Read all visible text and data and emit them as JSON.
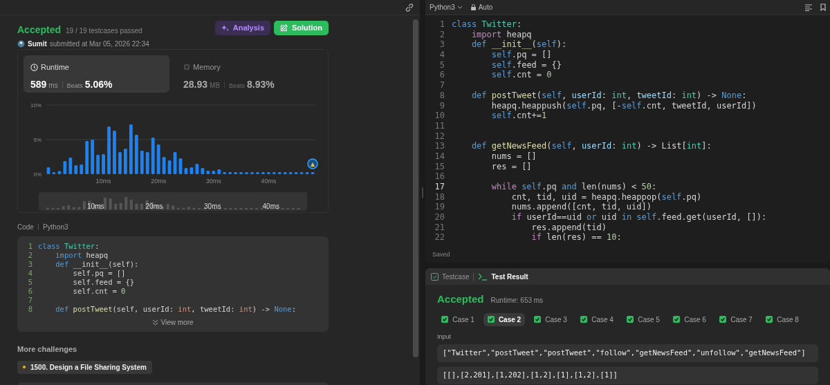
{
  "left_panel": {
    "status": "Accepted",
    "testcases": "19 / 19 testcases passed",
    "user": "Sumit",
    "submitted": "submitted at Mar 05, 2026 22:34",
    "buttons": [
      {
        "label": "Analysis",
        "kind": "analysis"
      },
      {
        "label": "Solution",
        "kind": "solution"
      }
    ],
    "metrics": [
      {
        "label": "Runtime",
        "value": "589",
        "unit": "ms",
        "beats_label": "Beats",
        "beats": "5.06%",
        "selected": true,
        "kind": "clock"
      },
      {
        "label": "Memory",
        "value": "28.93",
        "unit": "MB",
        "beats_label": "Beats",
        "beats": "8.93%",
        "selected": false,
        "kind": "chip"
      }
    ],
    "chart_data": {
      "type": "bar",
      "x": [
        0,
        1,
        2,
        3,
        4,
        5,
        6,
        7,
        8,
        9,
        10,
        11,
        12,
        13,
        14,
        15,
        16,
        17,
        18,
        19,
        20,
        21,
        22,
        23,
        24,
        25,
        26,
        27,
        28,
        29,
        30,
        31,
        32,
        33,
        34,
        35,
        36,
        37,
        38,
        39,
        40,
        41,
        42,
        43,
        44,
        45,
        46,
        47,
        48
      ],
      "values": [
        1.0,
        0.3,
        0.45,
        1.9,
        2.4,
        1.3,
        1.4,
        4.8,
        5.0,
        2.8,
        2.9,
        6.9,
        6.3,
        3.2,
        3.7,
        7.2,
        5.7,
        3.4,
        3.2,
        5.3,
        4.3,
        2.5,
        2.0,
        3.2,
        2.3,
        0.9,
        1.0,
        1.5,
        0.9,
        0.5,
        0.5,
        0.7,
        0.3,
        0.3,
        0.3,
        0.3,
        0.3,
        0.3,
        0.3,
        0.3,
        0.3,
        0.3,
        0.3,
        0.3,
        0.3,
        0.3,
        0.3,
        0.3,
        0.3
      ],
      "xlim": [
        -0.5,
        48.5
      ],
      "ylim": [
        0,
        10
      ],
      "yticks": [
        {
          "value": 0,
          "label": "0%"
        },
        {
          "value": 5,
          "label": "5%"
        },
        {
          "value": 10,
          "label": "10%"
        }
      ],
      "xticks": [
        {
          "value": 10,
          "label": "10ms"
        },
        {
          "value": 20,
          "label": "20ms"
        },
        {
          "value": 30,
          "label": "30ms"
        },
        {
          "value": 40,
          "label": "40ms"
        }
      ]
    },
    "overview_ticks": [
      "10ms",
      "20ms",
      "30ms",
      "40ms"
    ],
    "code_label": "Code",
    "code_language": "Python3",
    "code_lines": [
      {
        "n": "1",
        "tokens": [
          {
            "text": "class",
            "kind": "kw"
          },
          {
            "text": " Twitter",
            "kind": "cls"
          },
          {
            "text": ":",
            "kind": "p"
          }
        ]
      },
      {
        "n": "2",
        "tokens": [
          {
            "text": "    import",
            "kind": "kw"
          },
          {
            "text": " heapq",
            "kind": "p"
          }
        ]
      },
      {
        "n": "3",
        "tokens": [
          {
            "text": "    def",
            "kind": "kw"
          },
          {
            "text": " __init__(self):",
            "kind": "p"
          }
        ]
      },
      {
        "n": "4",
        "tokens": [
          {
            "text": "        self.pq = []",
            "kind": "p"
          }
        ]
      },
      {
        "n": "5",
        "tokens": [
          {
            "text": "        self.feed = {}",
            "kind": "p"
          }
        ]
      },
      {
        "n": "6",
        "tokens": [
          {
            "text": "        self.cnt = ",
            "kind": "p"
          },
          {
            "text": "0",
            "kind": "num"
          }
        ]
      },
      {
        "n": "7"
      },
      {
        "n": "8",
        "tokens": [
          {
            "text": "    def",
            "kind": "kw"
          },
          {
            "text": " postTweet",
            "kind": "fn"
          },
          {
            "text": "(self, userId: ",
            "kind": "p"
          },
          {
            "text": "int",
            "kind": "type"
          },
          {
            "text": ", tweetId: ",
            "kind": "p"
          },
          {
            "text": "int",
            "kind": "type"
          },
          {
            "text": ") -> ",
            "kind": "p"
          },
          {
            "text": "None",
            "kind": "kw"
          },
          {
            "text": ":",
            "kind": "p"
          }
        ]
      }
    ],
    "view_more": "View more",
    "more_challenges": "More challenges",
    "challenges": [
      {
        "title": "1500. Design a File Sharing System",
        "color": "#f5b800"
      }
    ]
  },
  "editor": {
    "language": "Python3",
    "mode": "Auto",
    "status": "Saved",
    "lines": [
      {
        "n": "1",
        "current": false,
        "tokens": [
          {
            "text": "class",
            "kind": "kw"
          },
          {
            "text": " Twitter",
            "kind": "cls"
          },
          {
            "text": ":",
            "kind": "p"
          }
        ]
      },
      {
        "n": "2",
        "current": false,
        "tokens": [
          {
            "text": "    import",
            "kind": "ctrl"
          },
          {
            "text": " heapq",
            "kind": "p"
          }
        ]
      },
      {
        "n": "3",
        "current": false,
        "tokens": [
          {
            "text": "    def",
            "kind": "kw"
          },
          {
            "text": " __init__",
            "kind": "fn"
          },
          {
            "text": "(",
            "kind": "p"
          },
          {
            "text": "self",
            "kind": "self"
          },
          {
            "text": "):",
            "kind": "p"
          }
        ]
      },
      {
        "n": "4",
        "current": false,
        "tokens": [
          {
            "text": "        self",
            "kind": "self"
          },
          {
            "text": ".pq = []",
            "kind": "p"
          }
        ]
      },
      {
        "n": "5",
        "current": false,
        "tokens": [
          {
            "text": "        self",
            "kind": "self"
          },
          {
            "text": ".feed = {}",
            "kind": "p"
          }
        ]
      },
      {
        "n": "6",
        "current": false,
        "tokens": [
          {
            "text": "        self",
            "kind": "self"
          },
          {
            "text": ".cnt = ",
            "kind": "p"
          },
          {
            "text": "0",
            "kind": "num"
          }
        ]
      },
      {
        "n": "7",
        "current": false
      },
      {
        "n": "8",
        "current": false,
        "tokens": [
          {
            "text": "    def",
            "kind": "kw"
          },
          {
            "text": " postTweet",
            "kind": "fn"
          },
          {
            "text": "(",
            "kind": "p"
          },
          {
            "text": "self",
            "kind": "self"
          },
          {
            "text": ", ",
            "kind": "p"
          },
          {
            "text": "userId",
            "kind": "param"
          },
          {
            "text": ": ",
            "kind": "p"
          },
          {
            "text": "int",
            "kind": "type"
          },
          {
            "text": ", ",
            "kind": "p"
          },
          {
            "text": "tweetId",
            "kind": "param"
          },
          {
            "text": ": ",
            "kind": "p"
          },
          {
            "text": "int",
            "kind": "type"
          },
          {
            "text": ") -> ",
            "kind": "p"
          },
          {
            "text": "None",
            "kind": "kw"
          },
          {
            "text": ":",
            "kind": "p"
          }
        ]
      },
      {
        "n": "9",
        "current": false,
        "tokens": [
          {
            "text": "        heapq.heappush(",
            "kind": "p"
          },
          {
            "text": "self",
            "kind": "self"
          },
          {
            "text": ".pq, [-",
            "kind": "p"
          },
          {
            "text": "self",
            "kind": "self"
          },
          {
            "text": ".cnt, tweetId, userId])",
            "kind": "p"
          }
        ]
      },
      {
        "n": "10",
        "current": false,
        "tokens": [
          {
            "text": "        self",
            "kind": "self"
          },
          {
            "text": ".cnt+=",
            "kind": "p"
          },
          {
            "text": "1",
            "kind": "num"
          }
        ]
      },
      {
        "n": "11",
        "current": false
      },
      {
        "n": "12",
        "current": false
      },
      {
        "n": "13",
        "current": false,
        "tokens": [
          {
            "text": "    def",
            "kind": "kw"
          },
          {
            "text": " getNewsFeed",
            "kind": "fn"
          },
          {
            "text": "(",
            "kind": "p"
          },
          {
            "text": "self",
            "kind": "self"
          },
          {
            "text": ", ",
            "kind": "p"
          },
          {
            "text": "userId",
            "kind": "param"
          },
          {
            "text": ": ",
            "kind": "p"
          },
          {
            "text": "int",
            "kind": "type"
          },
          {
            "text": ") -> List[",
            "kind": "p"
          },
          {
            "text": "int",
            "kind": "type"
          },
          {
            "text": "]:",
            "kind": "p"
          }
        ]
      },
      {
        "n": "14",
        "current": false,
        "tokens": [
          {
            "text": "        nums = []",
            "kind": "p"
          }
        ]
      },
      {
        "n": "15",
        "current": false,
        "tokens": [
          {
            "text": "        res = []",
            "kind": "p"
          }
        ]
      },
      {
        "n": "16",
        "current": false
      },
      {
        "n": "17",
        "current": true,
        "tokens": [
          {
            "text": "        while",
            "kind": "ctrl"
          },
          {
            "text": " self",
            "kind": "self"
          },
          {
            "text": ".pq ",
            "kind": "p"
          },
          {
            "text": "and",
            "kind": "kw"
          },
          {
            "text": " len(nums) < ",
            "kind": "p"
          },
          {
            "text": "50",
            "kind": "num"
          },
          {
            "text": ":",
            "kind": "p"
          }
        ]
      },
      {
        "n": "18",
        "current": false,
        "tokens": [
          {
            "text": "            cnt, tid, uid = heapq.heappop(",
            "kind": "p"
          },
          {
            "text": "self",
            "kind": "self"
          },
          {
            "text": ".pq)",
            "kind": "p"
          }
        ]
      },
      {
        "n": "19",
        "current": false,
        "tokens": [
          {
            "text": "            nums.append([cnt, tid, uid])",
            "kind": "p"
          }
        ]
      },
      {
        "n": "20",
        "current": false,
        "tokens": [
          {
            "text": "            if",
            "kind": "ctrl"
          },
          {
            "text": " userId==uid ",
            "kind": "p"
          },
          {
            "text": "or",
            "kind": "kw"
          },
          {
            "text": " uid ",
            "kind": "p"
          },
          {
            "text": "in",
            "kind": "kw"
          },
          {
            "text": " self",
            "kind": "self"
          },
          {
            "text": ".feed.get(userId, []):",
            "kind": "p"
          }
        ]
      },
      {
        "n": "21",
        "current": false,
        "tokens": [
          {
            "text": "                res.append(tid)",
            "kind": "p"
          }
        ]
      },
      {
        "n": "22",
        "current": false,
        "tokens": [
          {
            "text": "                if",
            "kind": "ctrl"
          },
          {
            "text": " len(res) == ",
            "kind": "p"
          },
          {
            "text": "10",
            "kind": "num"
          },
          {
            "text": ":",
            "kind": "p"
          }
        ]
      }
    ]
  },
  "result_panel": {
    "tabs": [
      {
        "label": "Testcase",
        "kind": "check",
        "selected": false
      },
      {
        "label": "Test Result",
        "kind": "terminal",
        "selected": true
      }
    ],
    "status": "Accepted",
    "runtime": "Runtime: 653 ms",
    "cases": [
      {
        "label": "Case 1",
        "selected": false
      },
      {
        "label": "Case 2",
        "selected": true
      },
      {
        "label": "Case 3",
        "selected": false
      },
      {
        "label": "Case 4",
        "selected": false
      },
      {
        "label": "Case 5",
        "selected": false
      },
      {
        "label": "Case 6",
        "selected": false
      },
      {
        "label": "Case 7",
        "selected": false
      },
      {
        "label": "Case 8",
        "selected": false
      }
    ],
    "input_label": "Input",
    "input_lines": [
      "[\"Twitter\",\"postTweet\",\"postTweet\",\"follow\",\"getNewsFeed\",\"unfollow\",\"getNewsFeed\"]",
      "[[],[2,201],[1,202],[1,2],[1],[1,2],[1]]"
    ]
  }
}
